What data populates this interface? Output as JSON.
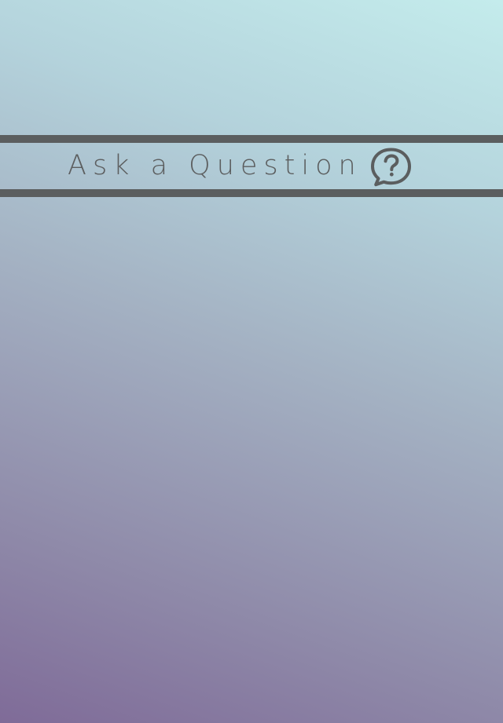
{
  "app": {
    "background_colors": [
      "#7f6b98",
      "#a4b2c3",
      "#c4ecec"
    ],
    "accent_color": "#5b5e5f"
  },
  "ask_question": {
    "label": "Ask a Question",
    "icon": "question-bubble-icon"
  }
}
